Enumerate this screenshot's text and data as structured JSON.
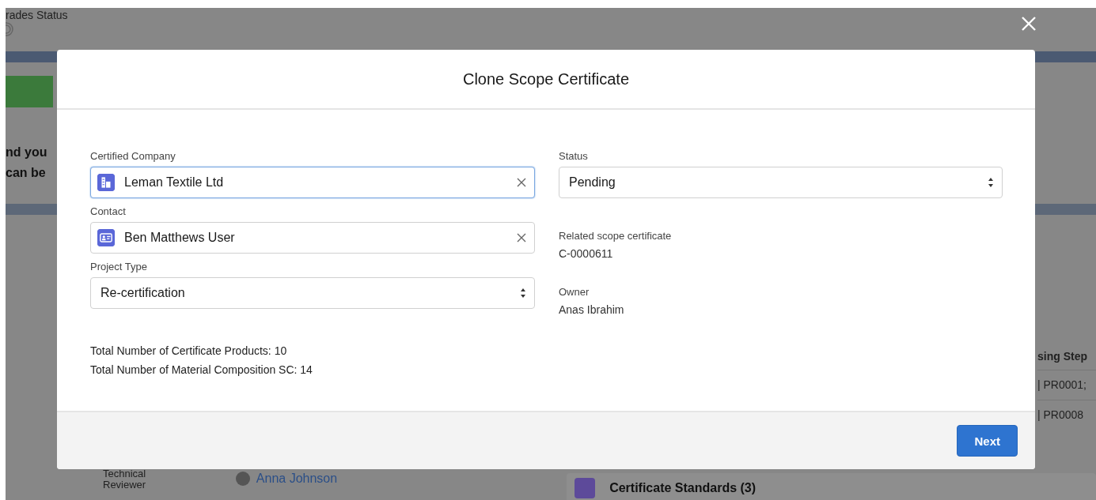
{
  "background": {
    "page_title": "rades Status",
    "banner_lines": [
      "nd you",
      "can be"
    ],
    "table": {
      "column_header": "sing Step",
      "rows": [
        "| PR0001;",
        "| PR0008"
      ]
    },
    "reviewer": {
      "label": "Technical Reviewer",
      "name": "Anna Johnson"
    },
    "related_list": {
      "title": "Certificate Standards (3)"
    }
  },
  "modal": {
    "title": "Clone Scope Certificate",
    "left_fields": [
      {
        "kind": "lookup",
        "label": "Certified Company",
        "value": "Leman Textile Ltd",
        "focused": true
      },
      {
        "kind": "lookup",
        "label": "Contact",
        "value": "Ben Matthews User",
        "focused": false
      },
      {
        "kind": "select",
        "label": "Project Type",
        "value": "Re-certification",
        "focused": false
      }
    ],
    "right_fields": [
      {
        "kind": "select",
        "label": "Status",
        "value": "Pending",
        "focused": false
      },
      {
        "kind": "readonly",
        "label": "Related scope certificate",
        "value": "C-0000611"
      },
      {
        "kind": "readonly",
        "label": "Owner",
        "value": "Anas Ibrahim"
      }
    ],
    "summary": [
      "Total Number of Certificate Products: 10",
      "Total Number of Material Composition SC: 14"
    ],
    "buttons": [
      {
        "label": "Next"
      }
    ]
  }
}
